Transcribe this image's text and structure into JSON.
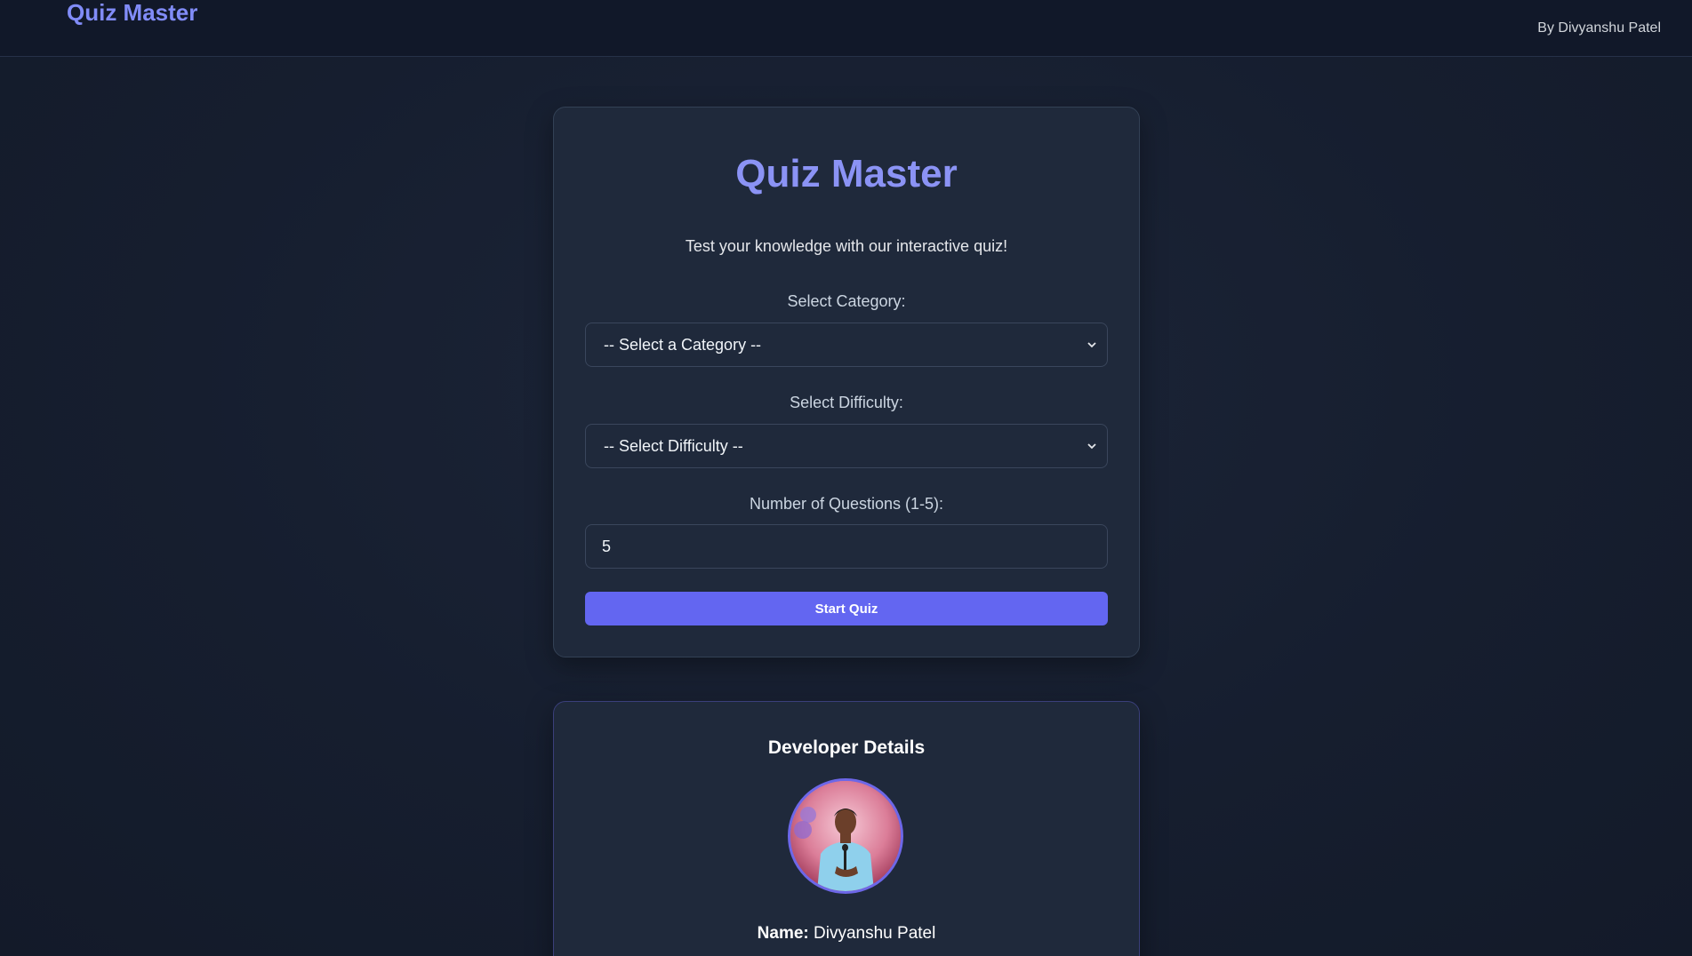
{
  "header": {
    "brand": "Quiz Master",
    "byline": "By Divyanshu Patel"
  },
  "quiz": {
    "title": "Quiz Master",
    "subtitle": "Test your knowledge with our interactive quiz!",
    "category_label": "Select Category:",
    "category_selected": "-- Select a Category --",
    "difficulty_label": "Select Difficulty:",
    "difficulty_selected": "-- Select Difficulty --",
    "questions_label": "Number of Questions (1-5):",
    "questions_value": "5",
    "start_label": "Start Quiz"
  },
  "developer": {
    "title": "Developer Details",
    "name_label": "Name:",
    "name_value": "Divyanshu Patel"
  },
  "colors": {
    "accent": "#6366f1",
    "brand": "#818cf8",
    "background": "#172033",
    "card": "#1f293b"
  },
  "icons": {
    "select_arrow": "chevron-down-icon"
  }
}
